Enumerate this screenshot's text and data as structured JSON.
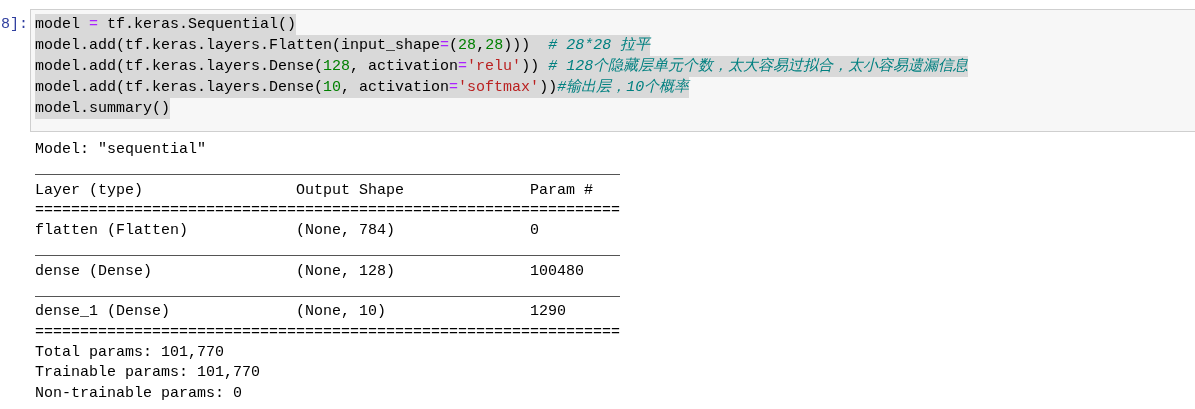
{
  "cell": {
    "prompt": "8]:",
    "code_lines": [
      {
        "selected": true,
        "tokens": [
          {
            "kind": "plain",
            "text": "model "
          },
          {
            "kind": "op",
            "text": "="
          },
          {
            "kind": "plain",
            "text": " tf.keras.Sequential()"
          }
        ]
      },
      {
        "selected": true,
        "tokens": [
          {
            "kind": "plain",
            "text": "model.add(tf.keras.layers.Flatten(input_shape"
          },
          {
            "kind": "op",
            "text": "="
          },
          {
            "kind": "plain",
            "text": "("
          },
          {
            "kind": "num",
            "text": "28"
          },
          {
            "kind": "plain",
            "text": ","
          },
          {
            "kind": "num",
            "text": "28"
          },
          {
            "kind": "plain",
            "text": ")))  "
          },
          {
            "kind": "comment",
            "text": "# 28*28 拉平"
          }
        ]
      },
      {
        "selected": true,
        "tokens": [
          {
            "kind": "plain",
            "text": "model.add(tf.keras.layers.Dense("
          },
          {
            "kind": "num",
            "text": "128"
          },
          {
            "kind": "plain",
            "text": ", activation"
          },
          {
            "kind": "op",
            "text": "="
          },
          {
            "kind": "str",
            "text": "'relu'"
          },
          {
            "kind": "plain",
            "text": ")) "
          },
          {
            "kind": "comment",
            "text": "# 128个隐藏层单元个数，太大容易过拟合，太小容易遗漏信息"
          }
        ]
      },
      {
        "selected": true,
        "tokens": [
          {
            "kind": "plain",
            "text": "model.add(tf.keras.layers.Dense("
          },
          {
            "kind": "num",
            "text": "10"
          },
          {
            "kind": "plain",
            "text": ", activation"
          },
          {
            "kind": "op",
            "text": "="
          },
          {
            "kind": "str",
            "text": "'softmax'"
          },
          {
            "kind": "plain",
            "text": "))"
          },
          {
            "kind": "comment",
            "text": "#输出层，10个概率"
          }
        ]
      },
      {
        "selected": true,
        "tokens": [
          {
            "kind": "plain",
            "text": "model.summary()"
          }
        ]
      }
    ]
  },
  "output": {
    "lines": [
      "Model: \"sequential\"",
      "_________________________________________________________________",
      "Layer (type)                 Output Shape              Param #",
      "=================================================================",
      "flatten (Flatten)            (None, 784)               0",
      "_________________________________________________________________",
      "dense (Dense)                (None, 128)               100480",
      "_________________________________________________________________",
      "dense_1 (Dense)              (None, 10)                1290",
      "=================================================================",
      "Total params: 101,770",
      "Trainable params: 101,770",
      "Non-trainable params: 0"
    ]
  }
}
